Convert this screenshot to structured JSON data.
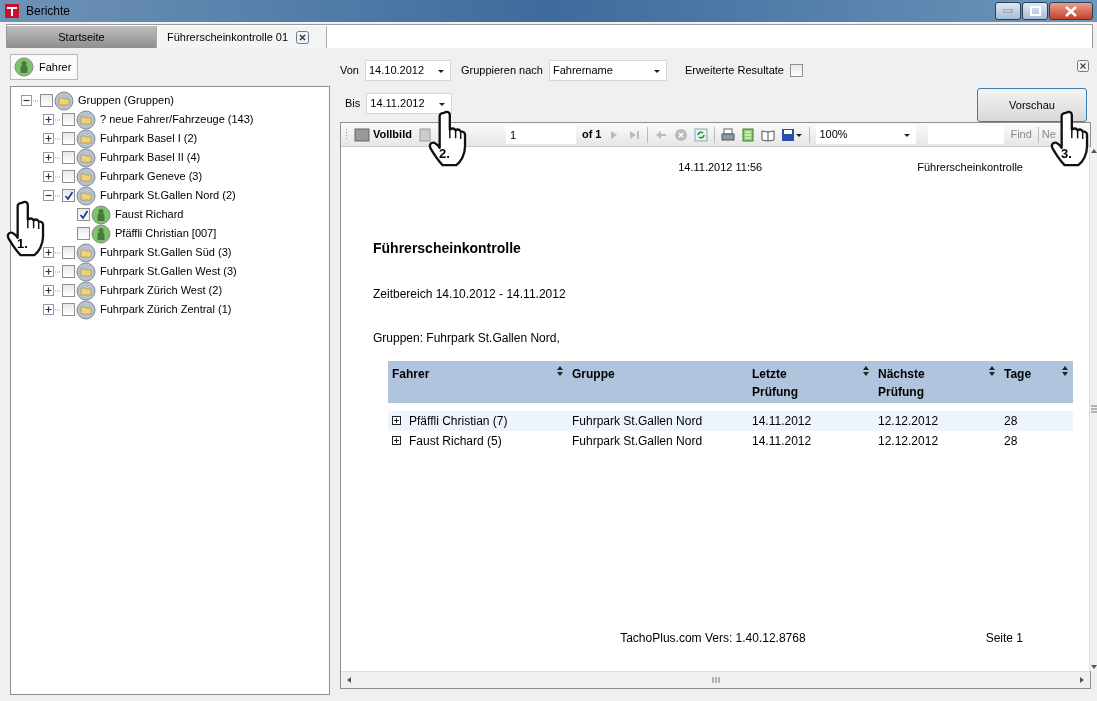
{
  "window": {
    "title": "Berichte"
  },
  "tabs": [
    {
      "label": "Startseite",
      "selected": false
    },
    {
      "label": "Führerscheinkontrolle 01",
      "selected": true
    }
  ],
  "sidebar": {
    "tab": "Fahrer",
    "tree": [
      {
        "label": "Gruppen (Gruppen)",
        "kind": "group",
        "checked": false,
        "expanded": true,
        "children": [
          {
            "label": "? neue Fahrer/Fahrzeuge (143)",
            "kind": "group",
            "checked": false,
            "expanded": false
          },
          {
            "label": "Fuhrpark Basel I (2)",
            "kind": "group",
            "checked": false,
            "expanded": false
          },
          {
            "label": "Fuhrpark Basel II (4)",
            "kind": "group",
            "checked": false,
            "expanded": false
          },
          {
            "label": "Fuhrpark Geneve (3)",
            "kind": "group",
            "checked": false,
            "expanded": false
          },
          {
            "label": "Fuhrpark St.Gallen Nord (2)",
            "kind": "group",
            "checked": true,
            "expanded": true,
            "children": [
              {
                "label": "Faust Richard",
                "kind": "driver",
                "checked": true
              },
              {
                "label": "Pfäffli Christian [007]",
                "kind": "driver",
                "checked": false
              }
            ]
          },
          {
            "label": "Fuhrpark St.Gallen Süd (3)",
            "kind": "group",
            "checked": false,
            "expanded": false
          },
          {
            "label": "Fuhrpark St.Gallen West (3)",
            "kind": "group",
            "checked": false,
            "expanded": false
          },
          {
            "label": "Fuhrpark Zürich West (2)",
            "kind": "group",
            "checked": false,
            "expanded": false
          },
          {
            "label": "Fuhrpark Zürich Zentral (1)",
            "kind": "group",
            "checked": false,
            "expanded": false
          }
        ]
      }
    ]
  },
  "filters": {
    "von": {
      "label": "Von",
      "value": "14.10.2012"
    },
    "bis": {
      "label": "Bis",
      "value": "14.11.2012"
    },
    "group_by": {
      "label": "Gruppieren nach",
      "value": "Fahrername"
    },
    "extended": {
      "label": "Erweiterte Resultate",
      "checked": false
    },
    "preview_button": "Vorschau"
  },
  "toolbar": {
    "fullscreen": "Vollbild",
    "page": "1",
    "of": "of",
    "page_count": "1",
    "zoom": "100%",
    "find": "Find",
    "next": "Ne"
  },
  "report": {
    "timestamp": "14.11.2012 11:56",
    "header_title": "Führerscheinkontrolle",
    "title": "Führerscheinkontrolle",
    "range": "Zeitbereich 14.10.2012 - 14.11.2012",
    "groups": "Gruppen: Fuhrpark St.Gallen Nord,",
    "columns": [
      {
        "label": "Fahrer",
        "sortable": true
      },
      {
        "label": "Gruppe",
        "sortable": false
      },
      {
        "label": "Letzte Prüfung",
        "sortable": true
      },
      {
        "label": "Nächste Prüfung",
        "sortable": true
      },
      {
        "label": "Tage",
        "sortable": true
      }
    ],
    "rows": [
      {
        "cells": [
          "Pfäffli Christian (7)",
          "Fuhrpark St.Gallen Nord",
          "14.11.2012",
          "12.12.2012",
          "28"
        ],
        "selected": true
      },
      {
        "cells": [
          "Faust Richard (5)",
          "Fuhrpark St.Gallen Nord",
          "14.11.2012",
          "12.12.2012",
          "28"
        ],
        "selected": false
      }
    ],
    "footer": "TachoPlus.com Vers: 1.40.12.8768",
    "page": "Seite 1"
  },
  "annotations": [
    {
      "label": "1."
    },
    {
      "label": "2."
    },
    {
      "label": "3."
    }
  ]
}
